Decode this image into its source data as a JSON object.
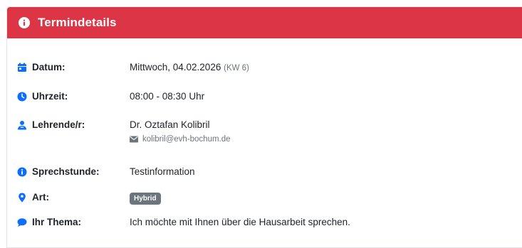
{
  "header": {
    "title": "Termindetails",
    "icon": "info-circle-icon",
    "color": "#dc3545"
  },
  "details": {
    "datum": {
      "label": "Datum:",
      "icon": "calendar-icon",
      "value": "Mittwoch, 04.02.2026",
      "week": "(KW 6)"
    },
    "uhrzeit": {
      "label": "Uhrzeit:",
      "icon": "clock-icon",
      "value": "08:00 - 08:30 Uhr"
    },
    "lehrende": {
      "label": "Lehrende/r:",
      "icon": "user-icon",
      "value": "Dr. Oztafan Kolibril",
      "email": "kolibril@evh-bochum.de",
      "email_icon": "envelope-icon"
    },
    "sprechstunde": {
      "label": "Sprechstunde:",
      "icon": "info-circle-icon",
      "value": "Testinformation"
    },
    "art": {
      "label": "Art:",
      "icon": "map-marker-icon",
      "badge": "Hybrid"
    },
    "thema": {
      "label": "Ihr Thema:",
      "icon": "comment-icon",
      "value": "Ich möchte mit Ihnen über die Hausarbeit sprechen."
    }
  },
  "colors": {
    "accent": "#0d6efd",
    "badge": "#6c757d"
  }
}
